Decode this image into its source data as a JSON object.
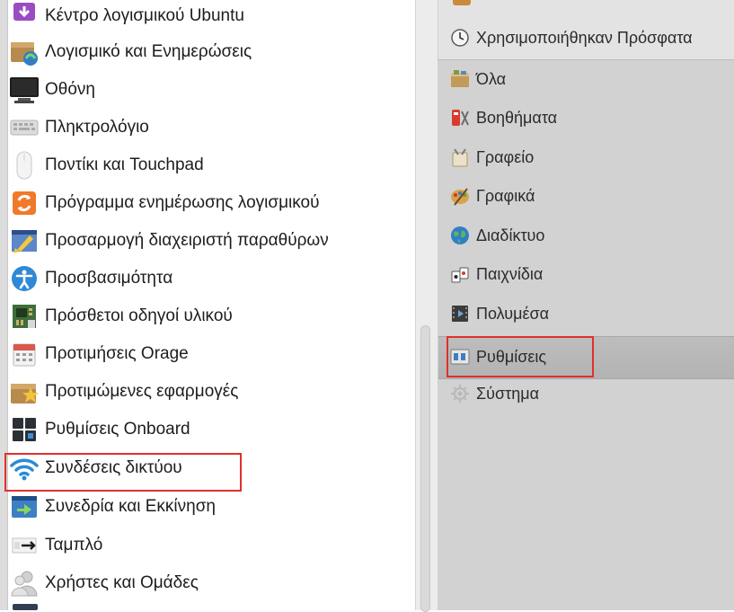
{
  "applications": [
    {
      "label": "Κέντρο λογισμικού Ubuntu",
      "icon": "ubuntu-software-center-icon"
    },
    {
      "label": "Λογισμικό και Ενημερώσεις",
      "icon": "software-updates-icon"
    },
    {
      "label": "Οθόνη",
      "icon": "display-icon"
    },
    {
      "label": "Πληκτρολόγιο",
      "icon": "keyboard-icon"
    },
    {
      "label": "Ποντίκι και Touchpad",
      "icon": "mouse-icon"
    },
    {
      "label": "Πρόγραμμα ενημέρωσης λογισμικού",
      "icon": "software-updater-icon"
    },
    {
      "label": "Προσαρμογή διαχειριστή παραθύρων",
      "icon": "window-manager-tweaks-icon"
    },
    {
      "label": "Προσβασιμότητα",
      "icon": "accessibility-icon"
    },
    {
      "label": "Πρόσθετοι οδηγοί υλικού",
      "icon": "additional-drivers-icon"
    },
    {
      "label": "Προτιμήσεις Orage",
      "icon": "calendar-icon"
    },
    {
      "label": "Προτιμώμενες εφαρμογές",
      "icon": "preferred-applications-icon"
    },
    {
      "label": "Ρυθμίσεις Onboard",
      "icon": "onboard-keyboard-icon"
    },
    {
      "label": "Συνδέσεις δικτύου",
      "icon": "wifi-icon"
    },
    {
      "label": "Συνεδρία και Εκκίνηση",
      "icon": "session-startup-icon"
    },
    {
      "label": "Ταμπλό",
      "icon": "panel-icon"
    },
    {
      "label": "Χρήστες και Ομάδες",
      "icon": "users-groups-icon"
    }
  ],
  "categories": [
    {
      "label": "Χρησιμοποιήθηκαν Πρόσφατα",
      "icon": "recent-clock-icon"
    },
    {
      "label": "Όλα",
      "icon": "all-folder-icon"
    },
    {
      "label": "Βοηθήματα",
      "icon": "accessories-icon"
    },
    {
      "label": "Γραφείο",
      "icon": "office-icon"
    },
    {
      "label": "Γραφικά",
      "icon": "graphics-palette-icon"
    },
    {
      "label": "Διαδίκτυο",
      "icon": "internet-globe-icon"
    },
    {
      "label": "Παιχνίδια",
      "icon": "games-icon"
    },
    {
      "label": "Πολυμέσα",
      "icon": "multimedia-icon"
    },
    {
      "label": "Ρυθμίσεις",
      "icon": "settings-icon"
    },
    {
      "label": "Σύστημα",
      "icon": "system-gear-icon"
    }
  ],
  "selected_category": "Ρυθμίσεις",
  "highlighted_application": "Συνδέσεις δικτύου",
  "highlight_color": "#e0302a"
}
